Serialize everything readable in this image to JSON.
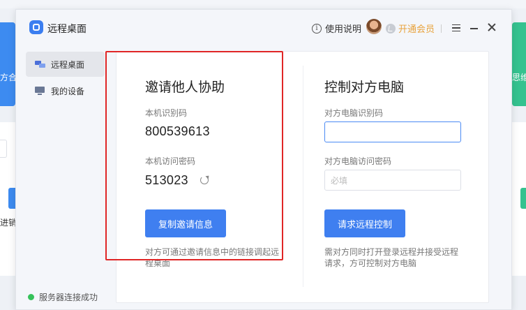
{
  "background": {
    "left_text_1": "方合",
    "left_text_2": "进销",
    "right_text_1": "思维"
  },
  "window": {
    "title": "远程桌面",
    "help_label": "使用说明",
    "vip_label": "开通会员"
  },
  "sidebar": {
    "items": [
      {
        "label": "远程桌面",
        "active": true
      },
      {
        "label": "我的设备",
        "active": false
      }
    ],
    "status": "服务器连接成功"
  },
  "invite": {
    "title": "邀请他人协助",
    "id_label": "本机识别码",
    "id_value": "800539613",
    "password_label": "本机访问密码",
    "password_value": "513023",
    "copy_button": "复制邀请信息",
    "note": "对方可通过邀请信息中的链接调起远程桌面"
  },
  "control": {
    "title": "控制对方电脑",
    "id_label": "对方电脑识别码",
    "id_value": "",
    "password_label": "对方电脑访问密码",
    "password_placeholder": "必填",
    "request_button": "请求远程控制",
    "note": "需对方同时打开登录远程并接受远程请求，方可控制对方电脑"
  },
  "colors": {
    "accent": "#3f7ff0",
    "highlight": "#e02626",
    "vip": "#e8a33d",
    "status_ok": "#35c25a"
  }
}
